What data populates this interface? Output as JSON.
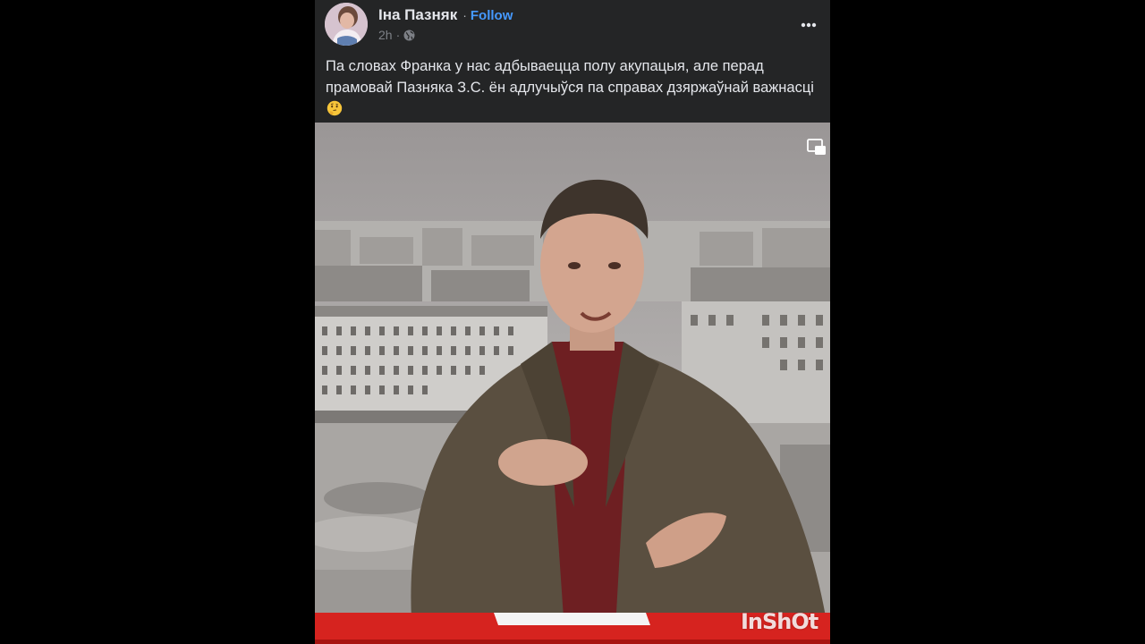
{
  "post": {
    "author": "Іна Пазняк",
    "follow_label": "Follow",
    "separator": "·",
    "time": "2h",
    "text": "Па словах Франка у нас адбываецца полу акупацыя, але перад прамовай Пазняка З.С. ён адлучыўся па справах дзяржаўнай важнасці",
    "emoji": "thinking-face-icon"
  },
  "video": {
    "watermark": "InShOt",
    "pip_icon": "picture-in-picture-icon"
  },
  "icons": {
    "avatar": "avatar",
    "privacy": "globe-icon",
    "more": "more-options-icon"
  },
  "colors": {
    "background": "#000000",
    "card": "#242526",
    "text": "#e4e6eb",
    "follow": "#4599ff",
    "muted": "#7d8086"
  }
}
